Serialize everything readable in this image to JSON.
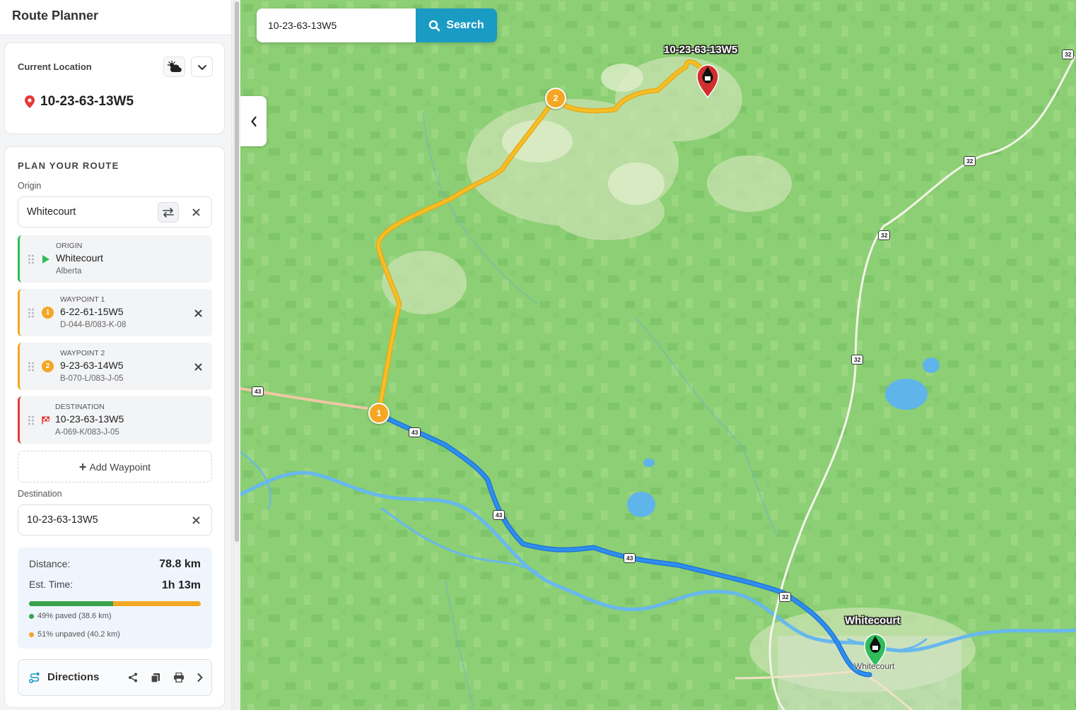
{
  "app": {
    "title": "Route Planner"
  },
  "current_location": {
    "label": "Current Location",
    "value": "10-23-63-13W5"
  },
  "plan": {
    "section_title": "PLAN YOUR ROUTE",
    "origin_label": "Origin",
    "origin_value": "Whitecourt",
    "stops": [
      {
        "kind": "ORIGIN",
        "name": "Whitecourt",
        "sub": "Alberta"
      },
      {
        "kind": "WAYPOINT 1",
        "number": "1",
        "name": "6-22-61-15W5",
        "sub": "D-044-B/083-K-08"
      },
      {
        "kind": "WAYPOINT 2",
        "number": "2",
        "name": "9-23-63-14W5",
        "sub": "B-070-L/083-J-05"
      },
      {
        "kind": "DESTINATION",
        "name": "10-23-63-13W5",
        "sub": "A-069-K/083-J-05"
      }
    ],
    "add_waypoint": "Add Waypoint",
    "destination_label": "Destination",
    "destination_value": "10-23-63-13W5"
  },
  "summary": {
    "distance_label": "Distance:",
    "distance_value": "78.8 km",
    "time_label": "Est. Time:",
    "time_value": "1h 13m",
    "paved_fraction": 0.49,
    "paved_text": "49% paved (38.6 km)",
    "unpaved_text": "51% unpaved (40.2 km)"
  },
  "directions": {
    "label": "Directions"
  },
  "map": {
    "search_value": "10-23-63-13W5",
    "search_button": "Search",
    "dest_label": "10-23-63-13W5",
    "origin_label": "Whitecourt",
    "town_label": "Whitecourt",
    "waypoint_1": "1",
    "waypoint_2": "2",
    "shields": [
      "32",
      "32",
      "32",
      "32",
      "43",
      "43",
      "43",
      "43",
      "32"
    ]
  },
  "colors": {
    "paved_route": "#2f8ff0",
    "unpaved_route": "#f6c025",
    "waypoint": "#f5a623",
    "origin_green": "#2ebd59",
    "destination_red": "#e53935",
    "search_button": "#1a9bc4",
    "map_green": "#8ccf74"
  },
  "icons": {
    "location": "map-pin-icon",
    "weather": "cloud-sun-icon",
    "swap": "swap-icon",
    "drag": "drag-handle-icon",
    "origin": "play-icon",
    "destination": "flag-icon",
    "directions": "route-icon",
    "share": "share-icon",
    "copy": "copy-icon",
    "print": "print-icon"
  }
}
